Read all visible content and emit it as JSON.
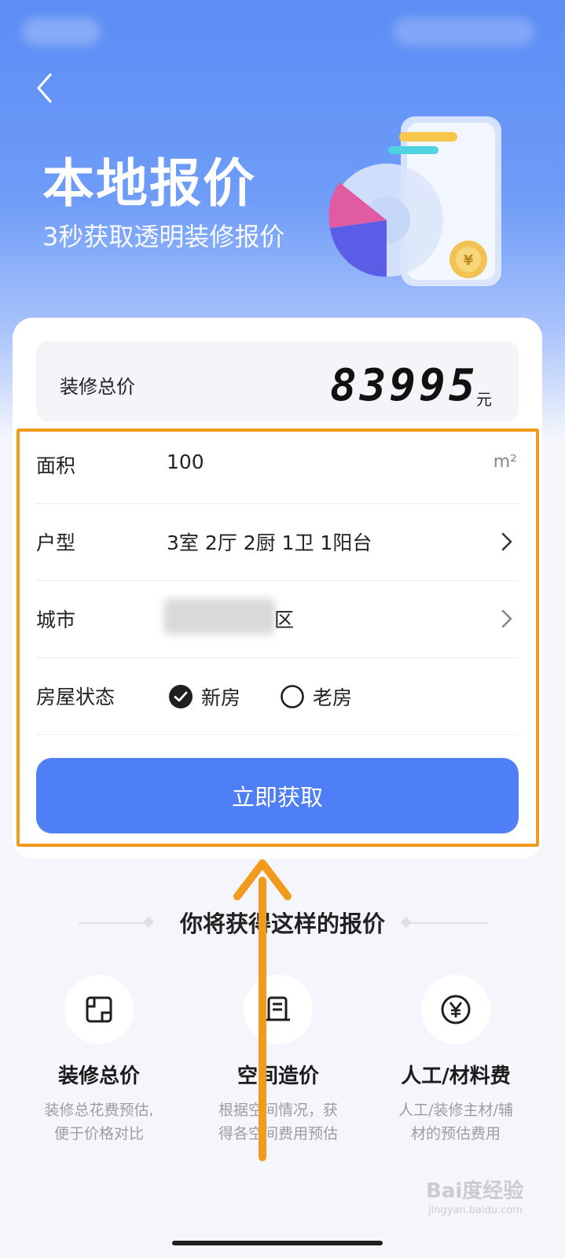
{
  "header": {
    "title": "本地报价",
    "subtitle": "3秒获取透明装修报价"
  },
  "total": {
    "label": "装修总价",
    "value": "83995",
    "unit": "元"
  },
  "form": {
    "area": {
      "label": "面积",
      "value": "100",
      "unit": "m²"
    },
    "layout": {
      "label": "户型",
      "value": "3室 2厅 2厨 1卫 1阳台"
    },
    "city": {
      "label": "城市",
      "value_suffix": "区"
    },
    "house_status": {
      "label": "房屋状态",
      "options": [
        {
          "label": "新房",
          "checked": true
        },
        {
          "label": "老房",
          "checked": false
        }
      ]
    },
    "submit_label": "立即获取"
  },
  "section": {
    "title": "你将获得这样的报价"
  },
  "features": [
    {
      "title": "装修总价",
      "desc_line1": "装修总花费预估,",
      "desc_line2": "便于价格对比",
      "icon": "floorplan-icon"
    },
    {
      "title": "空间造价",
      "desc_line1": "根据空间情况，获",
      "desc_line2": "得各空间费用预估",
      "icon": "document-icon"
    },
    {
      "title": "人工/材料费",
      "desc_line1": "人工/装修主材/辅",
      "desc_line2": "材的预估费用",
      "icon": "yuan-icon"
    }
  ],
  "watermark": {
    "text": "Bai度经验",
    "sub": "jingyan.baidu.com"
  },
  "colors": {
    "primary": "#4f7ff7",
    "hero": "#5b8df5",
    "highlight": "#f29a1c"
  }
}
